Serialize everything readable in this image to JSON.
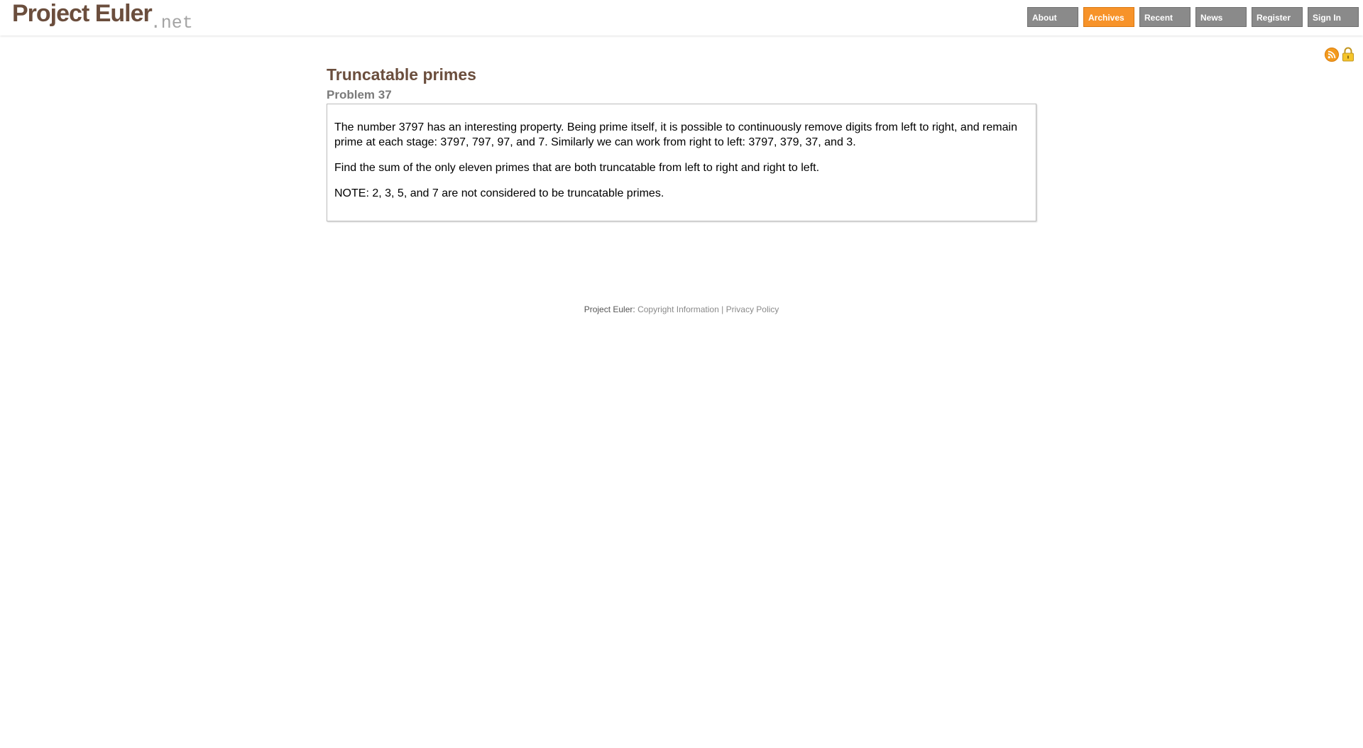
{
  "header": {
    "logo_main": "Project Euler",
    "logo_suffix": ".net",
    "nav": [
      {
        "label": "About",
        "active": false
      },
      {
        "label": "Archives",
        "active": true
      },
      {
        "label": "Recent",
        "active": false
      },
      {
        "label": "News",
        "active": false
      },
      {
        "label": "Register",
        "active": false
      },
      {
        "label": "Sign In",
        "active": false
      }
    ],
    "icons": [
      "rss-icon",
      "lock-icon"
    ]
  },
  "problem": {
    "title": "Truncatable primes",
    "number": "Problem 37",
    "paragraphs": [
      "The number 3797 has an interesting property. Being prime itself, it is possible to continuously remove digits from left to right, and remain prime at each stage: 3797, 797, 97, and 7. Similarly we can work from right to left: 3797, 379, 37, and 3.",
      "Find the sum of the only eleven primes that are both truncatable from left to right and right to left.",
      "NOTE: 2, 3, 5, and 7 are not considered to be truncatable primes."
    ]
  },
  "footer": {
    "prefix": "Project Euler:",
    "copyright_link": "Copyright Information",
    "separator": "|",
    "privacy_link": "Privacy Policy"
  },
  "colors": {
    "brand_brown": "#6b4e3d",
    "nav_gray": "#8a8a8a",
    "nav_active_orange": "#f7932a"
  }
}
